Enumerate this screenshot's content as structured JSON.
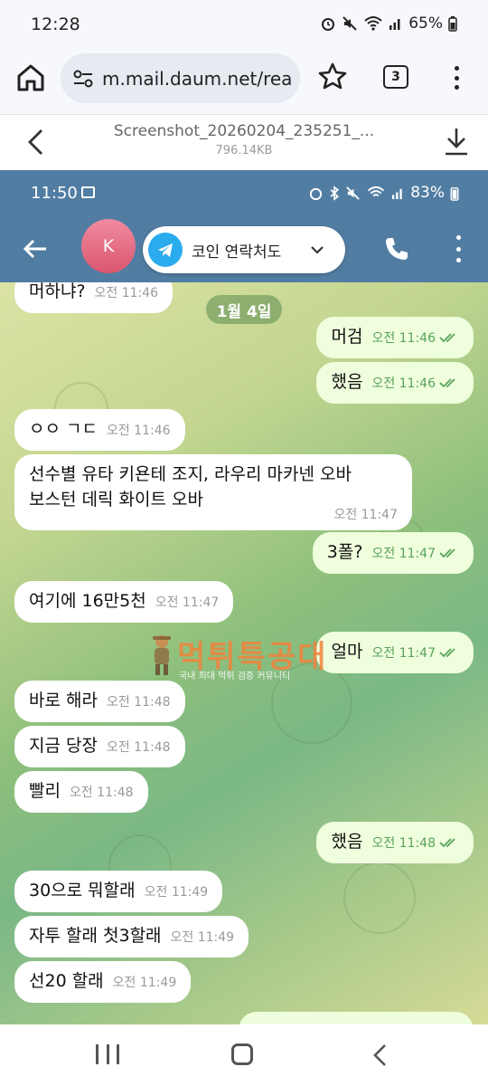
{
  "status_bar": {
    "time": "12:28",
    "battery": "65%"
  },
  "browser": {
    "url": "m.mail.daum.net/rea",
    "tab_count": "3"
  },
  "file": {
    "name": "Screenshot_20260204_235251_...",
    "size": "796.14KB"
  },
  "inner_status": {
    "time": "11:50",
    "battery": "83%"
  },
  "chat_header": {
    "avatar_letter": "K",
    "contact_name": "코인 연락처도"
  },
  "chat": {
    "date_chip": "1월 4일",
    "messages": [
      {
        "text": "머하냐?",
        "time": "오전 11:46",
        "dir": "in"
      },
      {
        "text": "머검",
        "time": "오전 11:46",
        "dir": "out"
      },
      {
        "text": "했음",
        "time": "오전 11:46",
        "dir": "out"
      },
      {
        "text": "ㅇㅇ ㄱㄷ",
        "time": "오전 11:46",
        "dir": "in"
      },
      {
        "text": "선수별 유타 키욘테 조지, 라우리 마카넨  오바",
        "text2": "보스턴 데릭 화이트 오바",
        "time": "오전 11:47",
        "dir": "in"
      },
      {
        "text": "3폴?",
        "time": "오전 11:47",
        "dir": "out"
      },
      {
        "text": "여기에 16만5천",
        "time": "오전 11:47",
        "dir": "in"
      },
      {
        "text": "얼마",
        "time": "오전 11:47",
        "dir": "out"
      },
      {
        "text": "바로 해라",
        "time": "오전 11:48",
        "dir": "in"
      },
      {
        "text": "지금 당장",
        "time": "오전 11:48",
        "dir": "in"
      },
      {
        "text": "빨리",
        "time": "오전 11:48",
        "dir": "in"
      },
      {
        "text": "했음",
        "time": "오전 11:48",
        "dir": "out"
      },
      {
        "text": "30으로 뭐할래",
        "time": "오전 11:49",
        "dir": "in"
      },
      {
        "text": "자투 할래 첫3할래",
        "time": "오전 11:49",
        "dir": "in"
      },
      {
        "text": "선20 할래",
        "time": "오전 11:49",
        "dir": "in"
      }
    ]
  },
  "watermark": {
    "title": "먹튀특공대",
    "subtitle": "국내 최대 먹튀 검증 커뮤니티"
  },
  "colors": {
    "header_blue": "#527da3",
    "outgoing_bubble": "#effedd",
    "telegram": "#2aabee"
  }
}
